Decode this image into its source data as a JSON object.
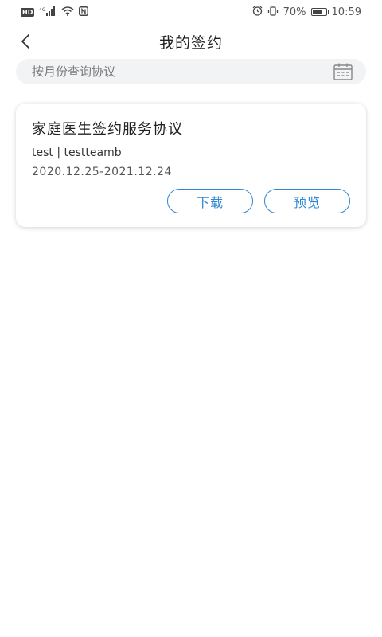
{
  "status_bar": {
    "left_badge": "HD",
    "network": "4G",
    "battery_percent": "70%",
    "battery_level": 0.7,
    "time": "10:59",
    "icons": [
      "hd-icon",
      "signal-icon",
      "wifi-icon",
      "nfc-icon",
      "alarm-icon",
      "vibrate-icon",
      "battery-icon"
    ]
  },
  "header": {
    "title": "我的签约",
    "back_icon": "chevron-left-icon"
  },
  "search": {
    "placeholder": "按月份查询协议",
    "value": "",
    "icon": "calendar-icon"
  },
  "agreements": [
    {
      "title": "家庭医生签约服务协议",
      "team": "test | testteamb",
      "period": "2020.12.25-2021.12.24",
      "download_label": "下载",
      "preview_label": "预览"
    }
  ],
  "colors": {
    "accent": "#2f86d3",
    "search_bg": "#f2f3f5",
    "text_primary": "#222222"
  }
}
